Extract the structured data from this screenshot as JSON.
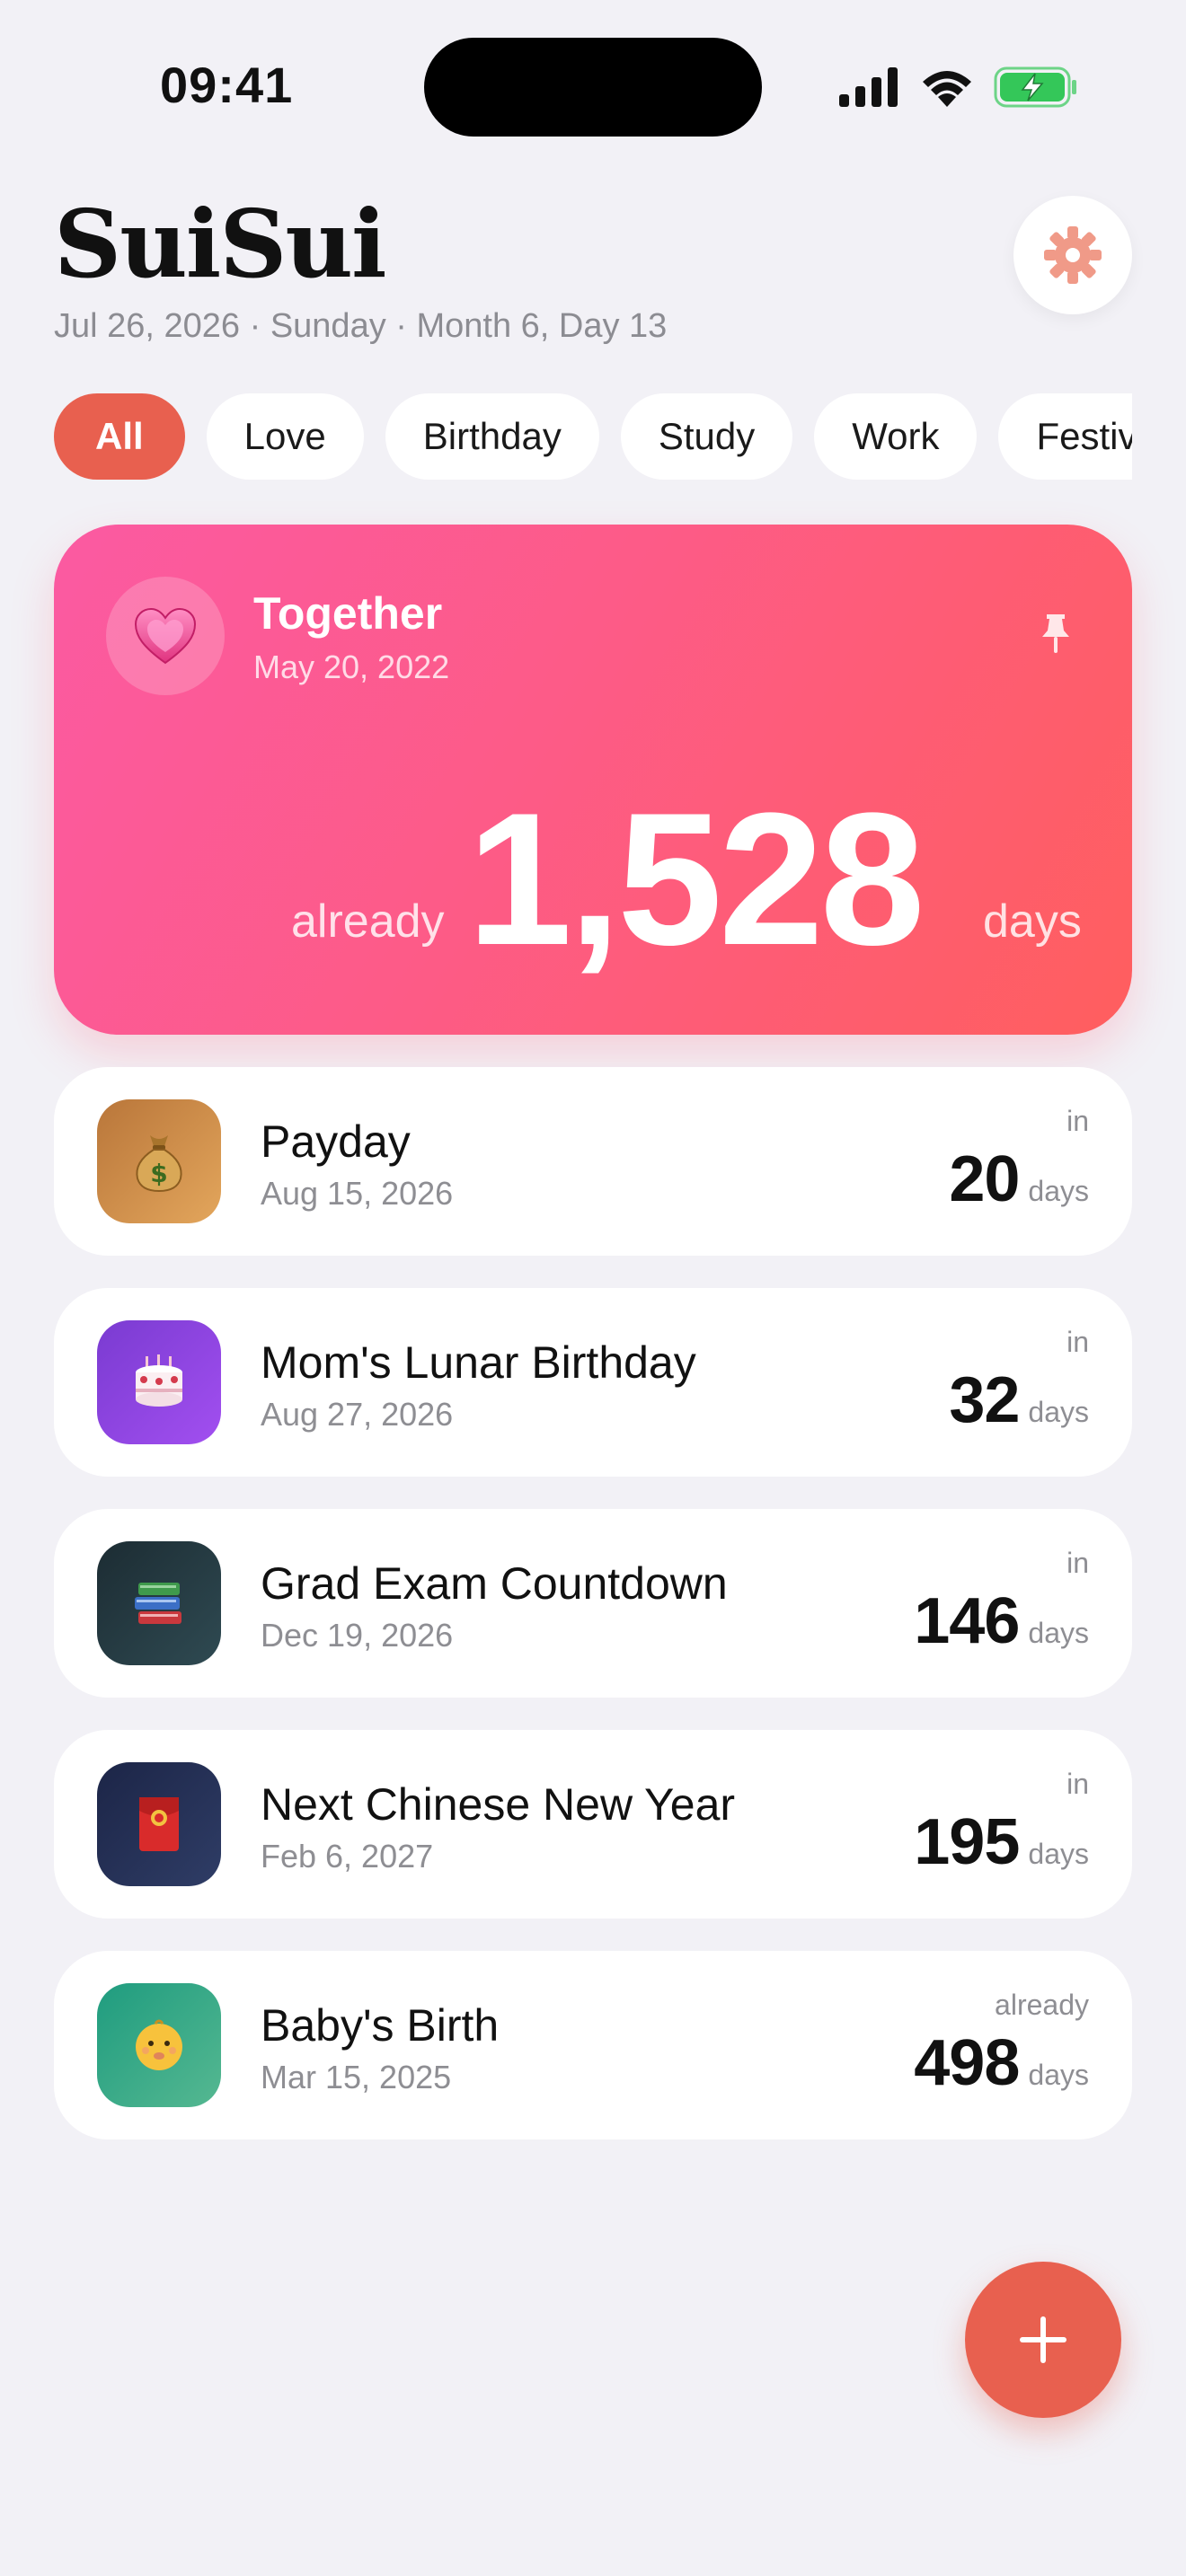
{
  "status_bar": {
    "time": "09:41"
  },
  "header": {
    "app_title": "SuiSui",
    "date_line": "Jul 26, 2026 · Sunday · Month 6, Day 13",
    "settings_icon": "gear-icon",
    "accent_color": "#e8604f"
  },
  "tabs": [
    {
      "label": "All",
      "active": true
    },
    {
      "label": "Love"
    },
    {
      "label": "Birthday"
    },
    {
      "label": "Study"
    },
    {
      "label": "Work"
    },
    {
      "label": "Festival"
    }
  ],
  "featured": {
    "emoji": "💗",
    "title": "Together",
    "date": "May 20, 2022",
    "relation": "already",
    "count": "1,528",
    "unit": "days",
    "pinned": true
  },
  "events": [
    {
      "emoji": "💰",
      "name": "Payday",
      "date": "Aug 15, 2026",
      "relation": "in",
      "count": "20",
      "unit": "days",
      "icon_bg": [
        "#b9763a",
        "#e3a65c"
      ]
    },
    {
      "emoji": "🎂",
      "name": "Mom's Lunar Birthday",
      "date": "Aug 27, 2026",
      "relation": "in",
      "count": "32",
      "unit": "days",
      "icon_bg": [
        "#7a3bd1",
        "#a24ff0"
      ]
    },
    {
      "emoji": "📚",
      "name": "Grad Exam Countdown",
      "date": "Dec 19, 2026",
      "relation": "in",
      "count": "146",
      "unit": "days",
      "icon_bg": [
        "#1c2c33",
        "#2f4a52"
      ]
    },
    {
      "emoji": "🧧",
      "name": "Next Chinese New Year",
      "date": "Feb 6, 2027",
      "relation": "in",
      "count": "195",
      "unit": "days",
      "icon_bg": [
        "#1c2547",
        "#2f3d66"
      ]
    },
    {
      "emoji": "👶",
      "name": "Baby's Birth",
      "date": "Mar 15, 2025",
      "relation": "already",
      "count": "498",
      "unit": "days",
      "icon_bg": [
        "#1f9c7f",
        "#55b891"
      ]
    }
  ],
  "fab": {
    "icon": "plus-icon"
  }
}
